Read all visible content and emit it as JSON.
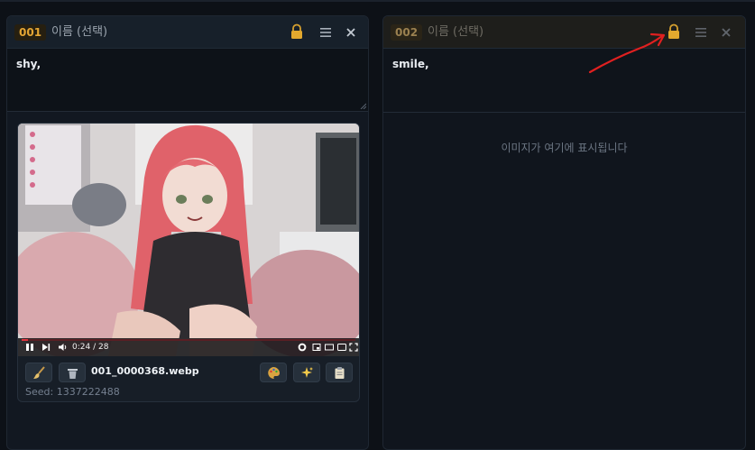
{
  "panels": [
    {
      "id": "001",
      "name_label": "이름 (선택)",
      "prompt": "shy,",
      "image": {
        "filename": "001_0000368.webp",
        "seed": "Seed: 1337222488",
        "video_time": "0:24 / 28"
      }
    },
    {
      "id": "002",
      "name_label": "이름 (선택)",
      "prompt": "smile,",
      "placeholder": "이미지가 여기에 표시됩니다"
    }
  ],
  "icons": {
    "lock": "lock-icon",
    "menu": "menu-icon",
    "close": "close-icon",
    "brush": "brush-icon",
    "trash": "trash-icon",
    "palette": "palette-icon",
    "sparkle": "sparkle-icon",
    "clipboard": "clipboard-icon"
  },
  "colors": {
    "accent": "#e5a634",
    "annotation": "#e02020",
    "background": "#0d1117"
  }
}
